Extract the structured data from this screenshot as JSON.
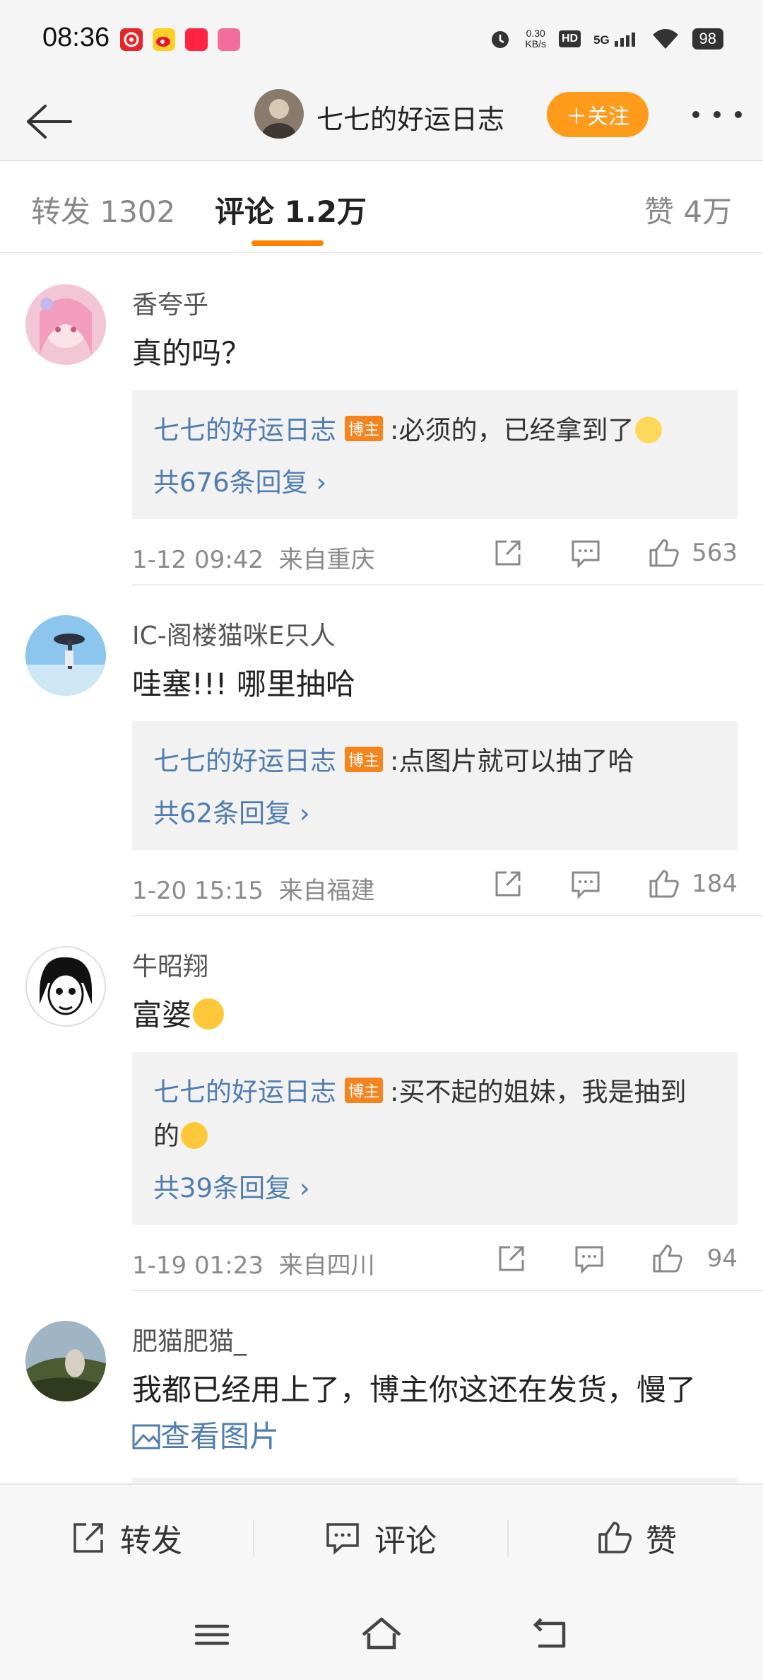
{
  "status_bar": {
    "time": "08:36",
    "net_speed_value": "0.30",
    "net_speed_unit": "KB/s",
    "hd_label": "HD",
    "network_label": "5G",
    "battery": "98",
    "app_icons": [
      "netease-music-icon",
      "weibo-icon",
      "xiaohongshu-icon",
      "lofter-icon"
    ],
    "icon_names": [
      "alarm-icon",
      "wifi-icon",
      "signal-icon"
    ]
  },
  "header": {
    "title": "七七的好运日志",
    "follow_label": "＋关注"
  },
  "tabs": [
    {
      "label": "转发 1302",
      "active": false
    },
    {
      "label": "评论 1.2万",
      "active": true
    },
    {
      "label": "赞 4万",
      "active": false
    }
  ],
  "comments": [
    {
      "user": "香夸乎",
      "text": "真的吗？",
      "reply_author": "七七的好运日志",
      "badge": "博主",
      "reply_text": ":必须的，已经拿到了",
      "reply_text_2": "",
      "reply_more": "共676条回复",
      "date": "1-12 09:42",
      "location": "来自重庆",
      "likes": "563"
    },
    {
      "user": "IC-阁楼猫咪E只人",
      "text": "哇塞!!!  哪里抽哈",
      "reply_author": "七七的好运日志",
      "badge": "博主",
      "reply_text": ":点图片就可以抽了哈",
      "reply_text_2": "",
      "reply_more": "共62条回复",
      "date": "1-20 15:15",
      "location": "来自福建",
      "likes": "184"
    },
    {
      "user": "牛昭翔",
      "text": "富婆",
      "reply_author": "七七的好运日志",
      "badge": "博主",
      "reply_text": ":买不起的姐妹，我是抽到",
      "reply_text_2": "的",
      "reply_more": "共39条回复",
      "date": "1-19 01:23",
      "location": "来自四川",
      "likes": "94"
    },
    {
      "user": "肥猫肥猫_",
      "text": "我都已经用上了，博主你这还在发货，慢了",
      "link": "查看图片"
    }
  ],
  "bottom_bar": {
    "repost": "转发",
    "comment": "评论",
    "like": "赞"
  },
  "colors": {
    "accent_orange": "#ff8200",
    "follow_button": "#ff9b1a",
    "link_blue": "#507daf",
    "badge_orange": "#f5841f"
  }
}
